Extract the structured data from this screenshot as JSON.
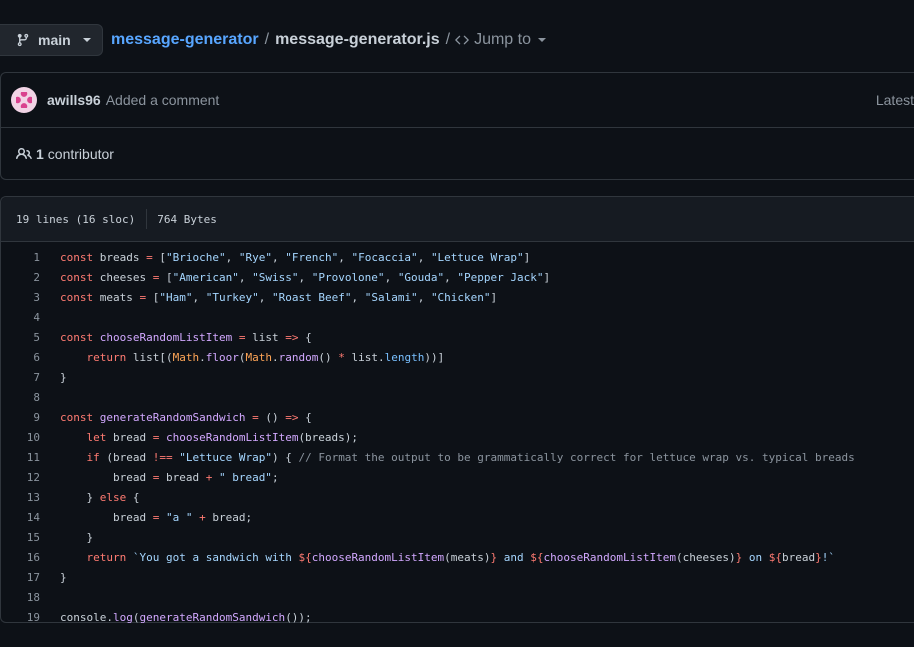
{
  "branch": {
    "name": "main"
  },
  "breadcrumb": {
    "repo": "message-generator",
    "separator": "/",
    "file": "message-generator.js",
    "separator2": "/",
    "jump_to": "Jump to"
  },
  "commit": {
    "author": "awills96",
    "message": "Added a comment",
    "latest_label": "Latest"
  },
  "contributors": {
    "count": "1",
    "label": "contributor"
  },
  "file_info": {
    "lines": "19 lines (16 sloc)",
    "size": "764 Bytes"
  },
  "code_lines": [
    "const breads = [\"Brioche\", \"Rye\", \"French\", \"Focaccia\", \"Lettuce Wrap\"]",
    "const cheeses = [\"American\", \"Swiss\", \"Provolone\", \"Gouda\", \"Pepper Jack\"]",
    "const meats = [\"Ham\", \"Turkey\", \"Roast Beef\", \"Salami\", \"Chicken\"]",
    "",
    "const chooseRandomListItem = list => {",
    "    return list[(Math.floor(Math.random() * list.length))]",
    "}",
    "",
    "const generateRandomSandwich = () => {",
    "    let bread = chooseRandomListItem(breads);",
    "    if (bread !== \"Lettuce Wrap\") { // Format the output to be grammatically correct for lettuce wrap vs. typical breads",
    "        bread = bread + \" bread\";",
    "    } else {",
    "        bread = \"a \" + bread;",
    "    }",
    "    return `You got a sandwich with ${chooseRandomListItem(meats)} and ${chooseRandomListItem(cheeses)} on ${bread}!`",
    "}",
    "",
    "console.log(generateRandomSandwich());"
  ],
  "colors": {
    "background": "#0d1117",
    "link": "#58a6ff",
    "keyword": "#ff7b72",
    "string": "#a5d6ff",
    "function": "#d2a8ff",
    "comment": "#8b949e"
  },
  "icons": [
    "git-branch-icon",
    "code-icon",
    "people-icon"
  ]
}
